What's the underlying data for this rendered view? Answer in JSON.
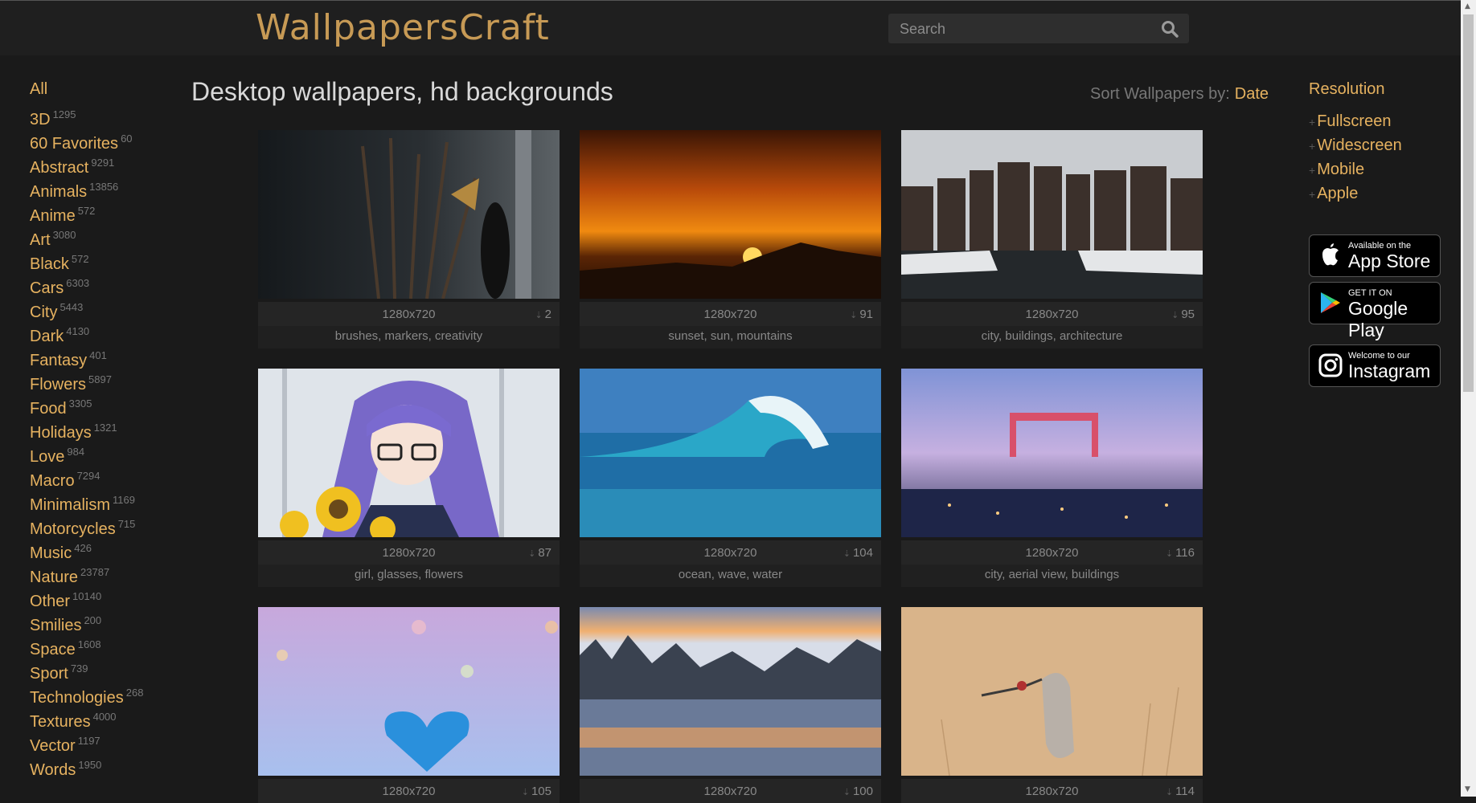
{
  "header": {
    "logo": "WallpapersCraft",
    "search_placeholder": "Search"
  },
  "page": {
    "title": "Desktop wallpapers, hd backgrounds",
    "sort_label": "Sort Wallpapers by:",
    "sort_value": "Date"
  },
  "categories": {
    "all": "All",
    "items": [
      {
        "name": "3D",
        "count": "1295"
      },
      {
        "name": "60 Favorites",
        "count": "60"
      },
      {
        "name": "Abstract",
        "count": "9291"
      },
      {
        "name": "Animals",
        "count": "13856"
      },
      {
        "name": "Anime",
        "count": "572"
      },
      {
        "name": "Art",
        "count": "3080"
      },
      {
        "name": "Black",
        "count": "572"
      },
      {
        "name": "Cars",
        "count": "6303"
      },
      {
        "name": "City",
        "count": "5443"
      },
      {
        "name": "Dark",
        "count": "4130"
      },
      {
        "name": "Fantasy",
        "count": "401"
      },
      {
        "name": "Flowers",
        "count": "5897"
      },
      {
        "name": "Food",
        "count": "3305"
      },
      {
        "name": "Holidays",
        "count": "1321"
      },
      {
        "name": "Love",
        "count": "984"
      },
      {
        "name": "Macro",
        "count": "7294"
      },
      {
        "name": "Minimalism",
        "count": "1169"
      },
      {
        "name": "Motorcycles",
        "count": "715"
      },
      {
        "name": "Music",
        "count": "426"
      },
      {
        "name": "Nature",
        "count": "23787"
      },
      {
        "name": "Other",
        "count": "10140"
      },
      {
        "name": "Smilies",
        "count": "200"
      },
      {
        "name": "Space",
        "count": "1608"
      },
      {
        "name": "Sport",
        "count": "739"
      },
      {
        "name": "Technologies",
        "count": "268"
      },
      {
        "name": "Textures",
        "count": "4000"
      },
      {
        "name": "Vector",
        "count": "1197"
      },
      {
        "name": "Words",
        "count": "1950"
      }
    ]
  },
  "wallpapers": [
    {
      "resolution": "1280x720",
      "downloads": "2",
      "tags": "brushes, markers, creativity"
    },
    {
      "resolution": "1280x720",
      "downloads": "91",
      "tags": "sunset, sun, mountains"
    },
    {
      "resolution": "1280x720",
      "downloads": "95",
      "tags": "city, buildings, architecture"
    },
    {
      "resolution": "1280x720",
      "downloads": "87",
      "tags": "girl, glasses, flowers"
    },
    {
      "resolution": "1280x720",
      "downloads": "104",
      "tags": "ocean, wave, water"
    },
    {
      "resolution": "1280x720",
      "downloads": "116",
      "tags": "city, aerial view, buildings"
    },
    {
      "resolution": "1280x720",
      "downloads": "105",
      "tags": ""
    },
    {
      "resolution": "1280x720",
      "downloads": "100",
      "tags": ""
    },
    {
      "resolution": "1280x720",
      "downloads": "114",
      "tags": ""
    }
  ],
  "sidebar": {
    "resolution_heading": "Resolution",
    "links": [
      "Fullscreen",
      "Widescreen",
      "Mobile",
      "Apple"
    ],
    "app_store": {
      "small": "Available on the",
      "big": "App Store"
    },
    "google_play": {
      "small": "GET IT ON",
      "big": "Google Play"
    },
    "instagram": {
      "small": "Welcome to our",
      "big": "Instagram"
    }
  }
}
